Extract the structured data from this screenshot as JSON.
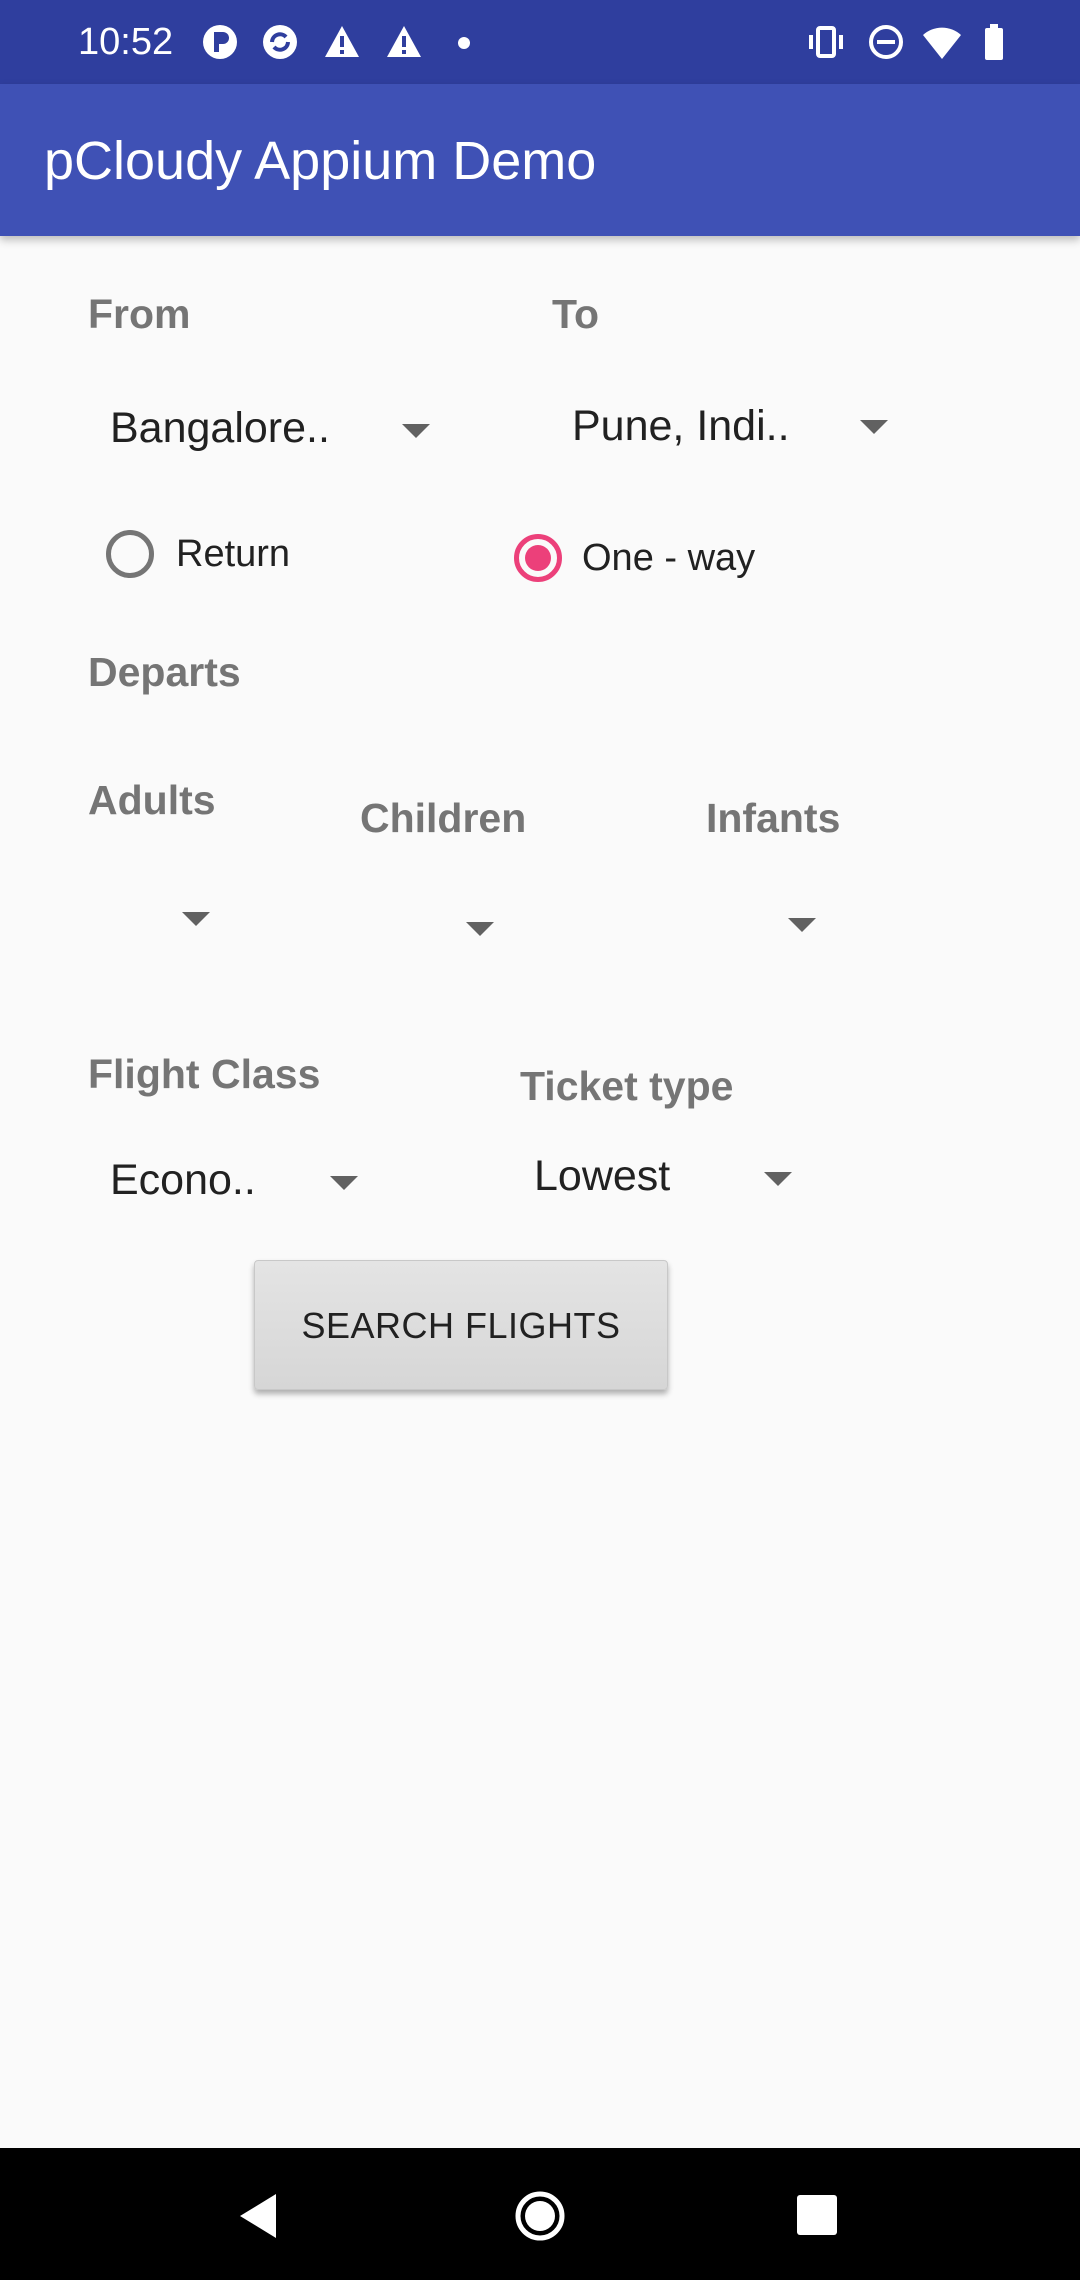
{
  "status_bar": {
    "time": "10:52",
    "left_icons": [
      "app-icon-p",
      "sync-icon",
      "warning-icon",
      "warning-icon",
      "dot-icon"
    ],
    "right_icons": [
      "vibrate-icon",
      "do-not-disturb-icon",
      "wifi-icon",
      "battery-icon"
    ],
    "bg_color": "#2f3e9e"
  },
  "app_bar": {
    "title": "pCloudy Appium Demo",
    "bg_color": "#3f51b5"
  },
  "form": {
    "from_label": "From",
    "to_label": "To",
    "from_value": "Bangalore..",
    "to_value": "Pune, Indi..",
    "trip_type": {
      "return_label": "Return",
      "oneway_label": "One - way",
      "selected": "One - way"
    },
    "departs_label": "Departs",
    "adults_label": "Adults",
    "children_label": "Children",
    "infants_label": "Infants",
    "adults_value": "",
    "children_value": "",
    "infants_value": "",
    "flight_class_label": "Flight Class",
    "ticket_type_label": "Ticket type",
    "flight_class_value": "Econo..",
    "ticket_type_value": "Lowest",
    "search_button": "SEARCH FLIGHTS",
    "accent_color": "#ec407a"
  },
  "nav_bar": {
    "icons": [
      "back-icon",
      "home-icon",
      "recents-icon"
    ]
  }
}
